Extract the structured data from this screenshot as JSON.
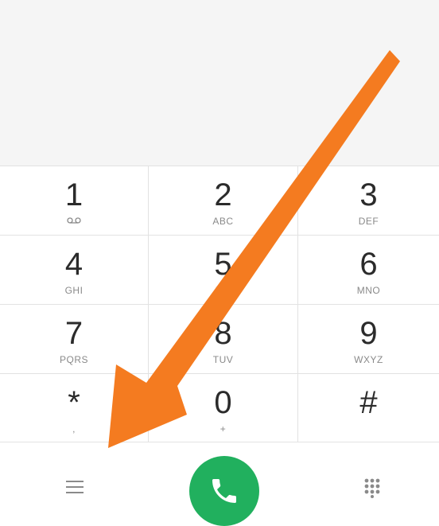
{
  "display": {
    "number": ""
  },
  "keypad": {
    "keys": [
      {
        "digit": "1",
        "letters": "",
        "icon": "voicemail-icon"
      },
      {
        "digit": "2",
        "letters": "ABC"
      },
      {
        "digit": "3",
        "letters": "DEF"
      },
      {
        "digit": "4",
        "letters": "GHI"
      },
      {
        "digit": "5",
        "letters": "JKL"
      },
      {
        "digit": "6",
        "letters": "MNO"
      },
      {
        "digit": "7",
        "letters": "PQRS"
      },
      {
        "digit": "8",
        "letters": "TUV"
      },
      {
        "digit": "9",
        "letters": "WXYZ"
      },
      {
        "digit": "*",
        "letters": ","
      },
      {
        "digit": "0",
        "letters": "+"
      },
      {
        "digit": "#",
        "letters": ""
      }
    ]
  },
  "bottom_bar": {
    "menu_icon": "menu-icon",
    "call_icon": "phone-icon",
    "dialpad_icon": "dialpad-icon"
  },
  "colors": {
    "call_button": "#21b05e",
    "annotation_arrow": "#f47b20",
    "display_background": "#f5f5f5"
  }
}
